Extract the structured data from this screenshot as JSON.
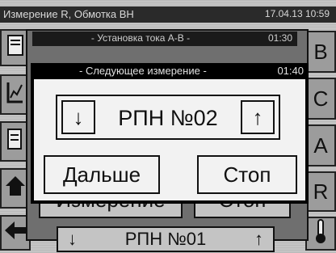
{
  "titlebar": {
    "title": "Измерение R, Обмотка ВН",
    "datetime": "17.04.13 10:59"
  },
  "right_buttons": [
    "B",
    "C",
    "A",
    "R"
  ],
  "background_dialog": {
    "header": "- Установка тока A-B -",
    "timer": "01:30",
    "measure_label": "Измерение",
    "stop_label": "Стоп",
    "selector_label": "РПН №01",
    "down_arrow": "↓",
    "up_arrow": "↑"
  },
  "dialog": {
    "header": "- Следующее измерение -",
    "timer": "01:40",
    "selector": {
      "label": "РПН №02",
      "down_arrow": "↓",
      "up_arrow": "↑"
    },
    "next_label": "Дальше",
    "stop_label": "Стоп"
  },
  "icons": [
    "document-icon",
    "chart-icon",
    "export-icon",
    "home-icon",
    "back-arrow-icon",
    "thermometer-icon"
  ]
}
